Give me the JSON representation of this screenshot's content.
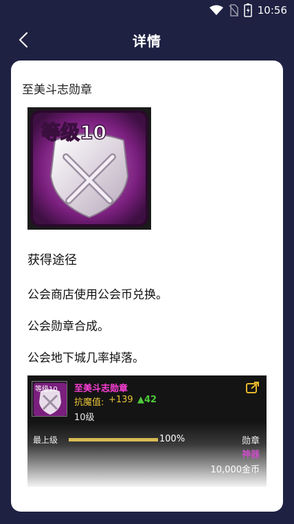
{
  "status_bar": {
    "time": "10:56"
  },
  "nav": {
    "title": "详情"
  },
  "item": {
    "name": "至美斗志勋章",
    "medal_text": "等级10"
  },
  "sources": {
    "title": "获得途径",
    "lines": [
      "公会商店使用公会币兑换。",
      "公会勋章合成。",
      "公会地下城几率掉落。"
    ]
  },
  "tooltip": {
    "name": "至美斗志勋章",
    "icon_text": "等级10",
    "stat_label": "抗魔值:",
    "stat_value": "+139",
    "stat_up": "▲42",
    "level": "10级",
    "max_label": "最上级",
    "progress_percent": 100,
    "progress_text": "100%",
    "type": "勋章",
    "grade": "神器",
    "price": "10,000金币"
  },
  "colors": {
    "background": "#1e2142",
    "medal_purple": "#8a2a8c",
    "tooltip_name": "#ff3fd8",
    "stat_gold": "#e8c23a",
    "stat_green": "#4ecb3a",
    "grade_purple": "#c84fc4"
  },
  "icons": [
    "wifi-icon",
    "no-sim-icon",
    "battery-icon",
    "back-chevron-icon",
    "share-icon"
  ]
}
